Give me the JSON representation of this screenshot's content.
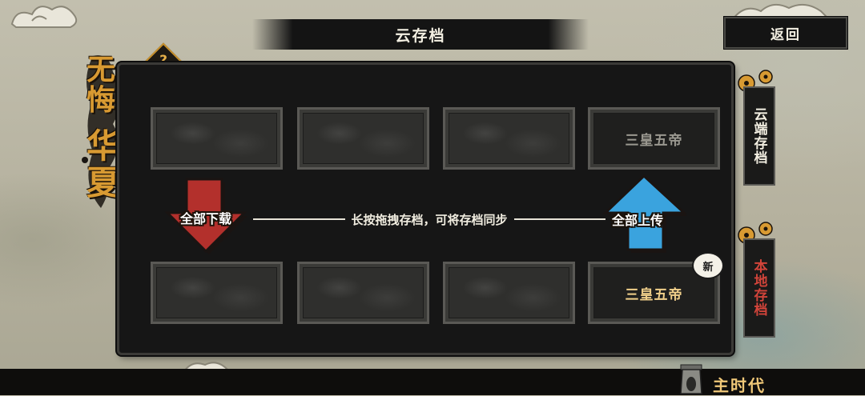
{
  "header": {
    "title": "云存档",
    "back_label": "返回"
  },
  "logo": {
    "line1": "无悔",
    "line2": "华夏"
  },
  "help": {
    "label": "?"
  },
  "cloud_slots": [
    {
      "name": ""
    },
    {
      "name": ""
    },
    {
      "name": ""
    },
    {
      "name": "三皇五帝"
    }
  ],
  "local_slots": [
    {
      "name": ""
    },
    {
      "name": ""
    },
    {
      "name": ""
    },
    {
      "name": "三皇五帝",
      "badge": "新"
    }
  ],
  "actions": {
    "download_all": "全部下载",
    "upload_all": "全部上传",
    "instruction": "长按拖拽存档，可将存档同步"
  },
  "side_tabs": {
    "cloud": "云端存档",
    "local": "本地存档"
  },
  "footer": {
    "era": "主时代"
  },
  "colors": {
    "download_arrow": "#b3302c",
    "upload_arrow": "#3aa3de",
    "gold": "#d89a32",
    "local_tab_text": "#d2443a",
    "cloud_tab_text": "#f3efe2"
  }
}
